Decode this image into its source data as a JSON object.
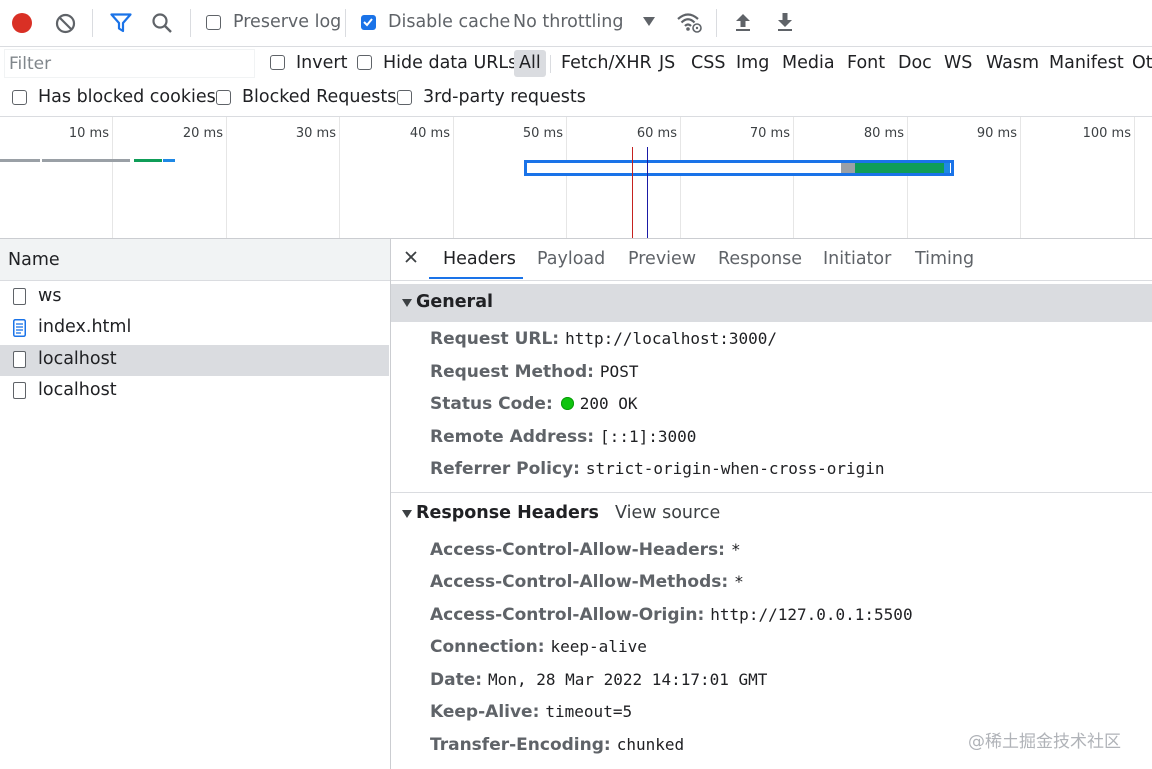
{
  "toolbar": {
    "preserve_log": "Preserve log",
    "preserve_log_checked": false,
    "disable_cache": "Disable cache",
    "disable_cache_checked": true,
    "throttling": "No throttling",
    "icons": [
      "record-icon",
      "clear-icon",
      "filter-icon",
      "search-icon",
      "network-conditions-icon",
      "import-har-icon",
      "export-har-icon"
    ],
    "record_color": "#d93025",
    "accent_color": "#1a73e8"
  },
  "filterbar": {
    "filter_placeholder": "Filter",
    "invert": "Invert",
    "hide_data_urls": "Hide data URLs",
    "types": [
      "All",
      "Fetch/XHR",
      "JS",
      "CSS",
      "Img",
      "Media",
      "Font",
      "Doc",
      "WS",
      "Wasm",
      "Manifest",
      "Ot"
    ],
    "active_type": "All"
  },
  "filterbar2": {
    "has_blocked_cookies": "Has blocked cookies",
    "blocked_requests": "Blocked Requests",
    "third_party": "3rd-party requests"
  },
  "overview": {
    "ticks": [
      "10 ms",
      "20 ms",
      "30 ms",
      "40 ms",
      "50 ms",
      "60 ms",
      "70 ms",
      "80 ms",
      "90 ms",
      "100 ms"
    ],
    "dom_content_loaded_color": "#1a1aa6",
    "load_color": "#c5221f"
  },
  "requests": {
    "header": "Name",
    "items": [
      {
        "name": "ws",
        "type": "blank",
        "selected": false
      },
      {
        "name": "index.html",
        "type": "document",
        "selected": false
      },
      {
        "name": "localhost",
        "type": "blank",
        "selected": true
      },
      {
        "name": "localhost",
        "type": "blank",
        "selected": false
      }
    ]
  },
  "details": {
    "tabs": [
      "Headers",
      "Payload",
      "Preview",
      "Response",
      "Initiator",
      "Timing"
    ],
    "active_tab": "Headers",
    "general": {
      "title": "General",
      "rows": [
        {
          "key": "Request URL:",
          "value": "http://localhost:3000/"
        },
        {
          "key": "Request Method:",
          "value": "POST"
        },
        {
          "key": "Status Code:",
          "value": "200 OK"
        },
        {
          "key": "Remote Address:",
          "value": "[::1]:3000"
        },
        {
          "key": "Referrer Policy:",
          "value": "strict-origin-when-cross-origin"
        }
      ]
    },
    "response_headers": {
      "title": "Response Headers",
      "view_source": "View source",
      "rows": [
        {
          "key": "Access-Control-Allow-Headers:",
          "value": "*"
        },
        {
          "key": "Access-Control-Allow-Methods:",
          "value": "*"
        },
        {
          "key": "Access-Control-Allow-Origin:",
          "value": "http://127.0.0.1:5500"
        },
        {
          "key": "Connection:",
          "value": "keep-alive"
        },
        {
          "key": "Date:",
          "value": "Mon, 28 Mar 2022 14:17:01 GMT"
        },
        {
          "key": "Keep-Alive:",
          "value": "timeout=5"
        },
        {
          "key": "Transfer-Encoding:",
          "value": "chunked"
        }
      ]
    }
  },
  "watermark": "@稀土掘金技术社区"
}
